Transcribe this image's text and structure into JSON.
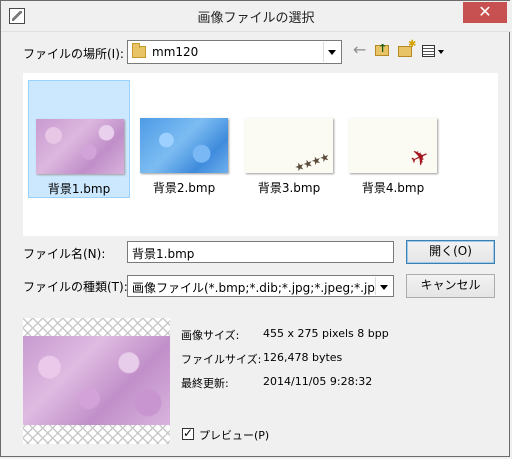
{
  "window": {
    "title": "画像ファイルの選択",
    "close_glyph": "✕"
  },
  "lookin": {
    "label": "ファイルの場所(I):",
    "value": "mm120"
  },
  "toolbar": {
    "back": "back-arrow-icon",
    "up": "up-folder-icon",
    "new_folder": "new-folder-icon",
    "views": "view-menu-icon"
  },
  "files": [
    {
      "name": "背景1.bmp",
      "selected": true
    },
    {
      "name": "背景2.bmp",
      "selected": false
    },
    {
      "name": "背景3.bmp",
      "selected": false
    },
    {
      "name": "背景4.bmp",
      "selected": false
    }
  ],
  "filename": {
    "label": "ファイル名(N):",
    "value": "背景1.bmp"
  },
  "filetype": {
    "label": "ファイルの種類(T):",
    "value": "画像ファイル(*.bmp;*.dib;*.jpg;*.jpeg;*.jpe"
  },
  "buttons": {
    "open": "開く(O)",
    "cancel": "キャンセル"
  },
  "info": {
    "size_label": "画像サイズ:",
    "size_value": "455 x 275 pixels 8 bpp",
    "filesize_label": "ファイルサイズ:",
    "filesize_value": "126,478 bytes",
    "modified_label": "最終更新:",
    "modified_value": "2014/11/05 9:28:32"
  },
  "preview": {
    "label": "プレビュー(P)",
    "checked": true
  }
}
